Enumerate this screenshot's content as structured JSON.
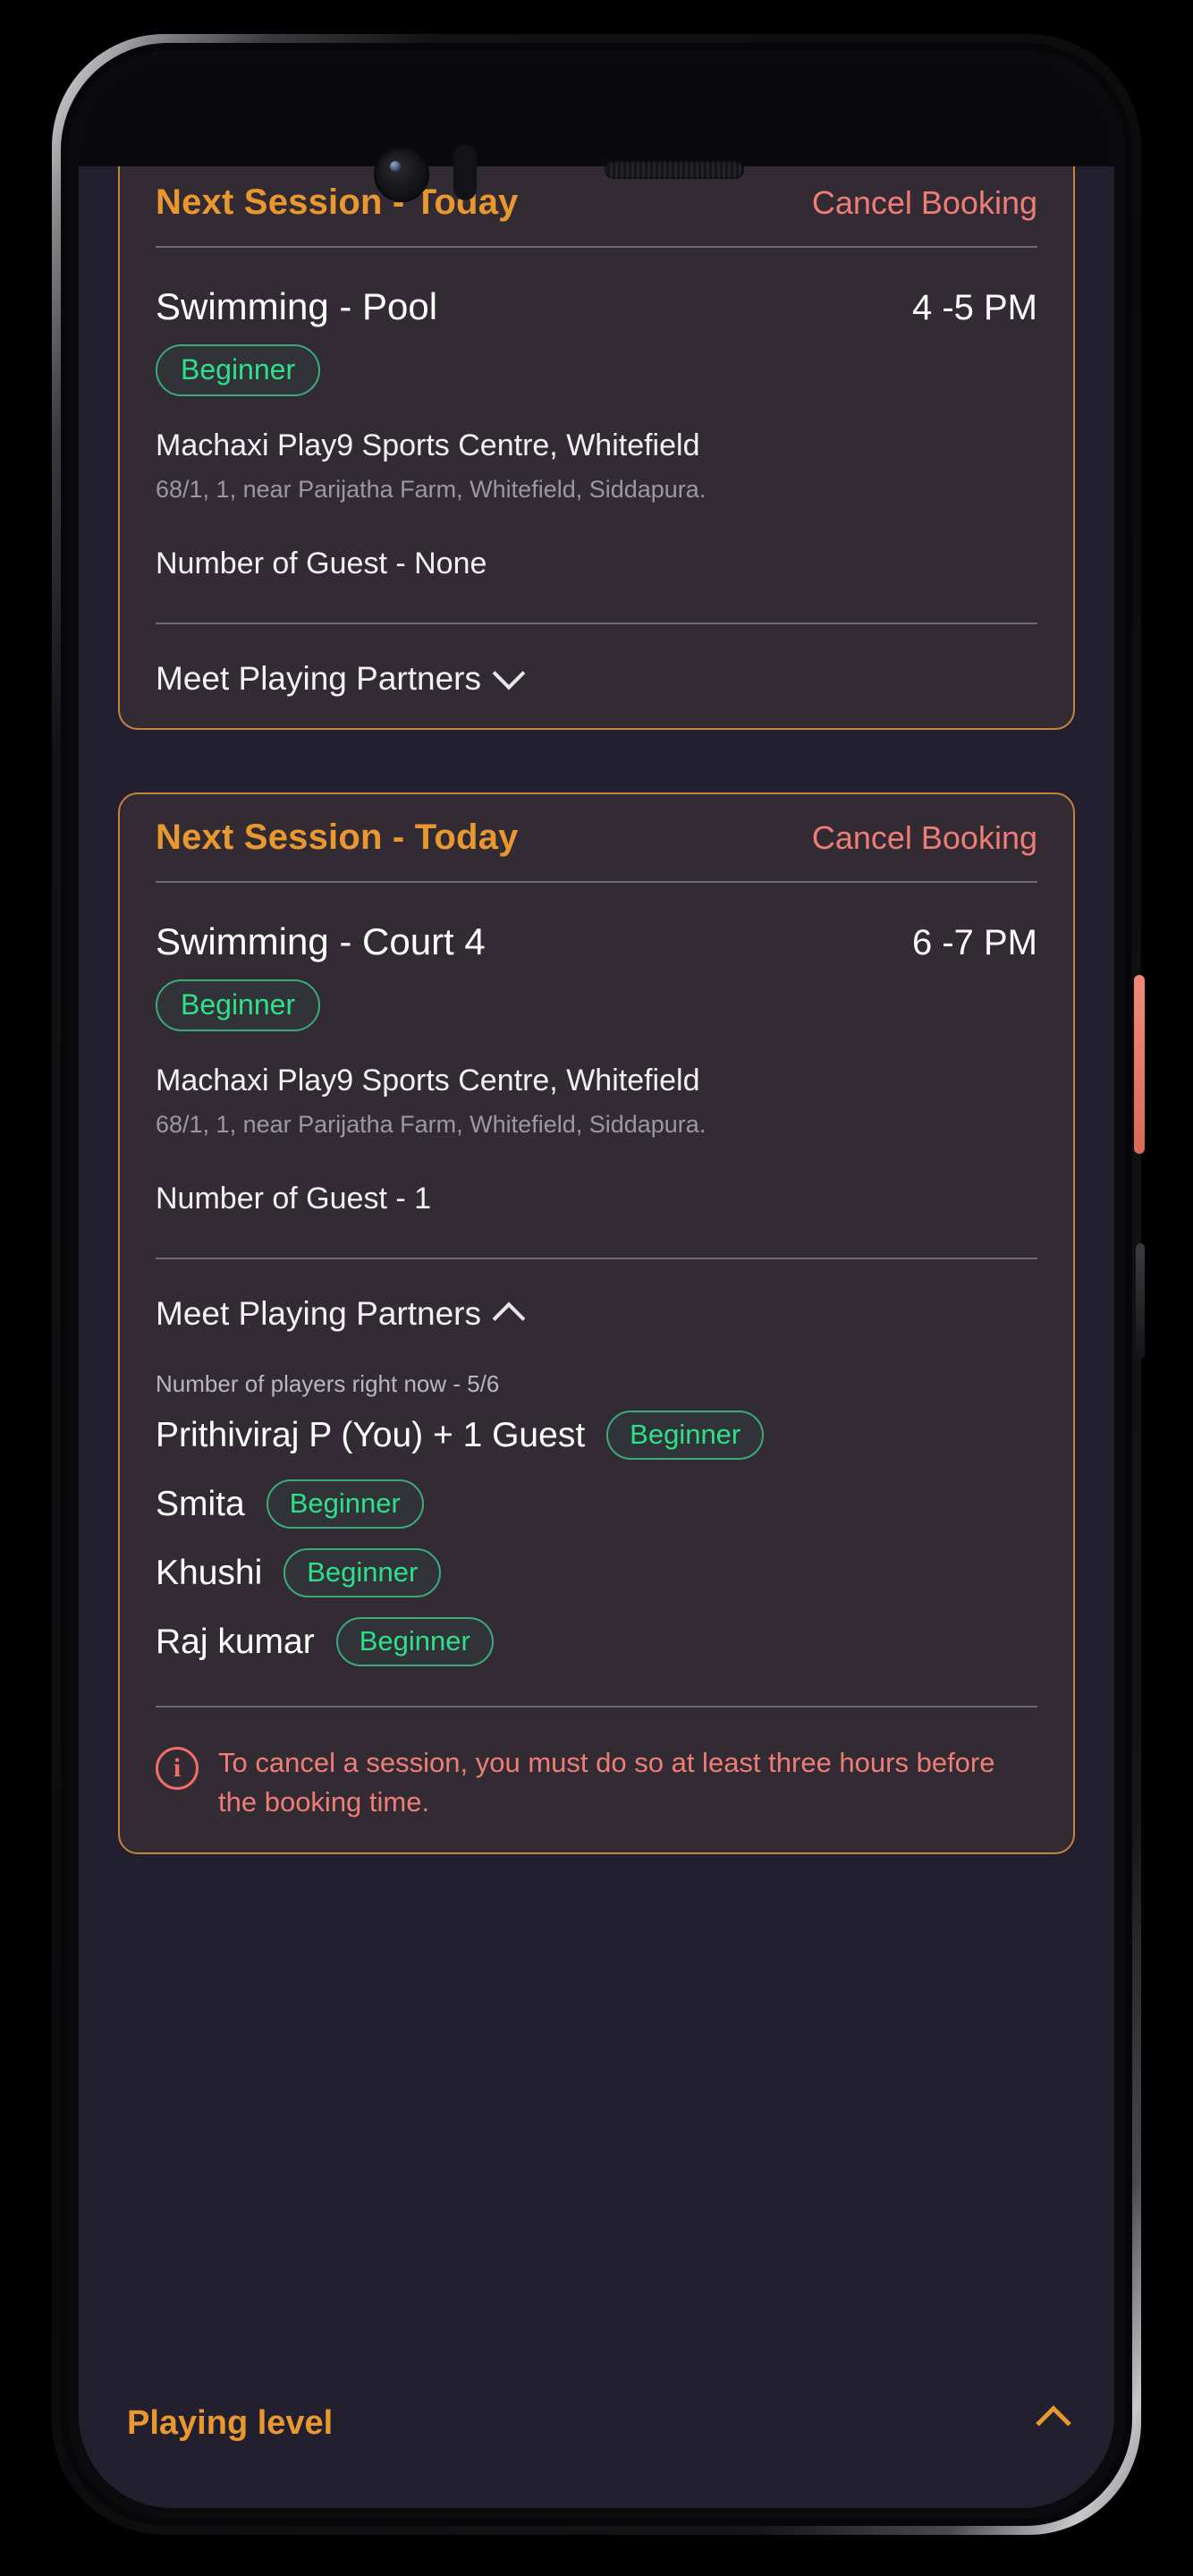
{
  "app": {
    "background_color": "#221f2e",
    "card_background": "#322b34",
    "accent_orange": "#e9972f",
    "accent_red": "#ef7d76",
    "accent_green": "#2ee08a"
  },
  "sessions": [
    {
      "header_title": "Next Session - Today",
      "cancel_label": "Cancel Booking",
      "sport": "Swimming - Pool",
      "time": "4 -5 PM",
      "level_pill": "Beginner",
      "venue": "Machaxi Play9 Sports Centre, Whitefield",
      "address": "68/1, 1, near Parijatha Farm, Whitefield, Siddapura.",
      "guests": "Number of Guest - None",
      "partners_label": "Meet Playing Partners",
      "partners_chevron": "chevron-down-icon",
      "expanded": false
    },
    {
      "header_title": "Next Session - Today",
      "cancel_label": "Cancel Booking",
      "sport": "Swimming - Court 4",
      "time": "6 -7 PM",
      "level_pill": "Beginner",
      "venue": "Machaxi Play9 Sports Centre, Whitefield",
      "address": "68/1, 1, near Parijatha Farm, Whitefield, Siddapura.",
      "guests": "Number of Guest - 1",
      "partners_label": "Meet Playing Partners",
      "partners_chevron": "chevron-up-icon",
      "expanded": true,
      "players_count_label": "Number of players right now - 5/6",
      "players": [
        {
          "name": "Prithiviraj P (You) + 1 Guest",
          "level": "Beginner"
        },
        {
          "name": "Smita",
          "level": "Beginner"
        },
        {
          "name": "Khushi",
          "level": "Beginner"
        },
        {
          "name": "Raj kumar",
          "level": "Beginner"
        }
      ],
      "notice_icon": "info-circle-icon",
      "notice_text": "To cancel a session, you must do so at least three hours before the booking time."
    }
  ],
  "bottom_sheet": {
    "title": "Playing level",
    "chevron": "chevron-up-icon"
  }
}
